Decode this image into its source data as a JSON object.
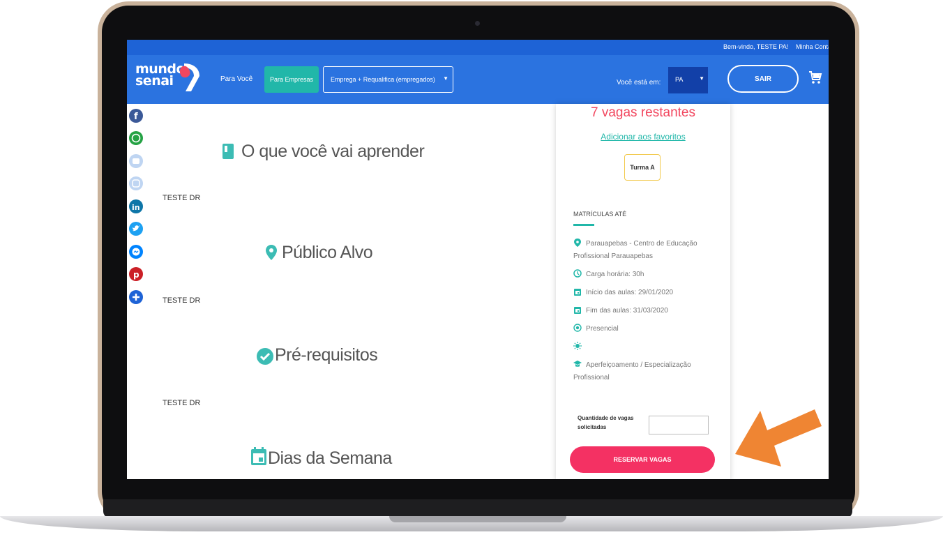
{
  "topbar": {
    "welcome": "Bem-vindo, TESTE PA!",
    "account": "Minha Conta"
  },
  "logo": {
    "line1": "mundo",
    "line2": "senai"
  },
  "nav": {
    "para_voce": "Para Você",
    "para_empresas": "Para Empresas",
    "select_value": "Emprega + Requalifica (empregados)",
    "location_label": "Você está em:",
    "location_value": "PA",
    "sair": "SAIR"
  },
  "social": [
    "facebook-icon",
    "whatsapp-icon",
    "youtube-icon",
    "instagram-icon",
    "linkedin-icon",
    "twitter-icon",
    "messenger-icon",
    "pinterest-icon",
    "plus-icon"
  ],
  "sections": [
    {
      "title": "O que você vai aprender",
      "text": "TESTE DR"
    },
    {
      "title": "Público Alvo",
      "text": "TESTE DR"
    },
    {
      "title": "Pré-requisitos",
      "text": "TESTE DR"
    },
    {
      "title": "Dias da Semana"
    }
  ],
  "panel": {
    "vagas": "7 vagas restantes",
    "favoritos": "Adicionar aos favoritos",
    "turma": "Turma A",
    "matriculas": "MATRÍCULAS ATÉ",
    "local": "Parauapebas - Centro de Educação Profissional Parauapebas",
    "carga": "Carga horária: 30h",
    "inicio": "Início das aulas: 29/01/2020",
    "fim": "Fim das aulas: 31/03/2020",
    "modalidade": "Presencial",
    "tipo": "Aperfeiçoamento / Especialização Profissional",
    "quantidade_label": "Quantidade de vagas solicitadas",
    "quantidade_value": "",
    "reservar": "RESERVAR VAGAS"
  },
  "colors": {
    "primary": "#2b73e0",
    "accent": "#21b7a9",
    "cta": "#f43163",
    "vagas": "#f2475f",
    "arrow": "#ef8533"
  }
}
